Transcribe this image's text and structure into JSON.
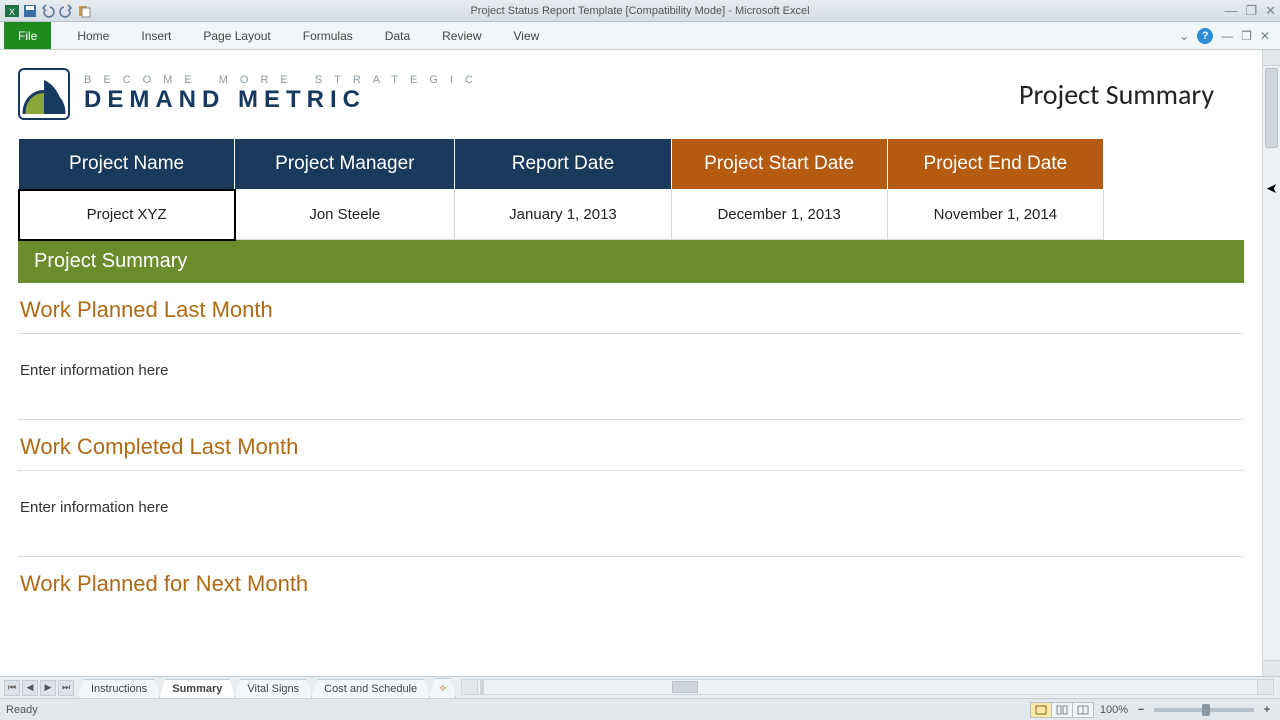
{
  "titlebar": {
    "title": "Project Status Report Template  [Compatibility Mode]  -  Microsoft Excel"
  },
  "ribbon": {
    "file": "File",
    "tabs": [
      "Home",
      "Insert",
      "Page Layout",
      "Formulas",
      "Data",
      "Review",
      "View"
    ]
  },
  "logo": {
    "tagline": "Become More Strategic",
    "brand": "DEMAND METRIC"
  },
  "page_title": "Project Summary",
  "info_headers": {
    "name": "Project Name",
    "manager": "Project Manager",
    "report_date": "Report Date",
    "start_date": "Project Start Date",
    "end_date": "Project End Date"
  },
  "info_values": {
    "name": "Project XYZ",
    "manager": "Jon Steele",
    "report_date": "January 1, 2013",
    "start_date": "December 1, 2013",
    "end_date": "November 1, 2014"
  },
  "band": "Project Summary",
  "sections": {
    "planned_last": {
      "heading": "Work Planned Last Month",
      "body": "Enter information here"
    },
    "completed_last": {
      "heading": "Work Completed Last Month",
      "body": "Enter information here"
    },
    "planned_next": {
      "heading": "Work Planned for Next Month",
      "body": ""
    }
  },
  "sheet_tabs": [
    "Instructions",
    "Summary",
    "Vital Signs",
    "Cost and Schedule"
  ],
  "active_sheet_tab": "Summary",
  "statusbar": {
    "ready": "Ready",
    "zoom": "100%"
  }
}
